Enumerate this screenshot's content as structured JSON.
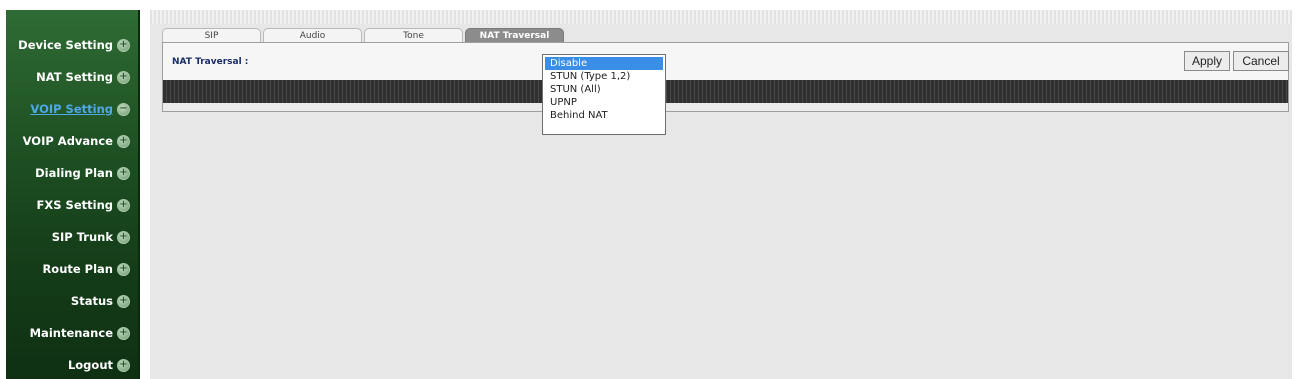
{
  "sidebar": {
    "items": [
      {
        "label": "Device Setting",
        "icon": "plus-circle-icon"
      },
      {
        "label": "NAT Setting",
        "icon": "plus-circle-icon"
      },
      {
        "label": "VOIP Setting",
        "icon": "minus-circle-icon",
        "active": true
      },
      {
        "label": "VOIP Advance",
        "icon": "plus-circle-icon"
      },
      {
        "label": "Dialing Plan",
        "icon": "plus-circle-icon"
      },
      {
        "label": "FXS Setting",
        "icon": "plus-circle-icon"
      },
      {
        "label": "SIP Trunk",
        "icon": "plus-circle-icon"
      },
      {
        "label": "Route Plan",
        "icon": "plus-circle-icon"
      },
      {
        "label": "Status",
        "icon": "plus-circle-icon"
      },
      {
        "label": "Maintenance",
        "icon": "plus-circle-icon"
      },
      {
        "label": "Logout",
        "icon": "plus-circle-icon"
      }
    ],
    "expand_glyph": "+",
    "collapse_glyph": "−"
  },
  "tabs": [
    {
      "label": "SIP"
    },
    {
      "label": "Audio"
    },
    {
      "label": "Tone"
    },
    {
      "label": "NAT Traversal",
      "active": true
    }
  ],
  "form": {
    "nat_label": "NAT Traversal :",
    "dropdown_options": [
      "Disable",
      "STUN (Type 1,2)",
      "STUN (All)",
      "UPNP",
      "Behind NAT"
    ],
    "selected_option": "Disable"
  },
  "buttons": {
    "apply": "Apply",
    "cancel": "Cancel"
  },
  "colors": {
    "sidebar_green": "#1f5224",
    "active_link": "#4fa8e8",
    "selected_option": "#3a8ee8",
    "active_tab": "#8c8c8c"
  }
}
